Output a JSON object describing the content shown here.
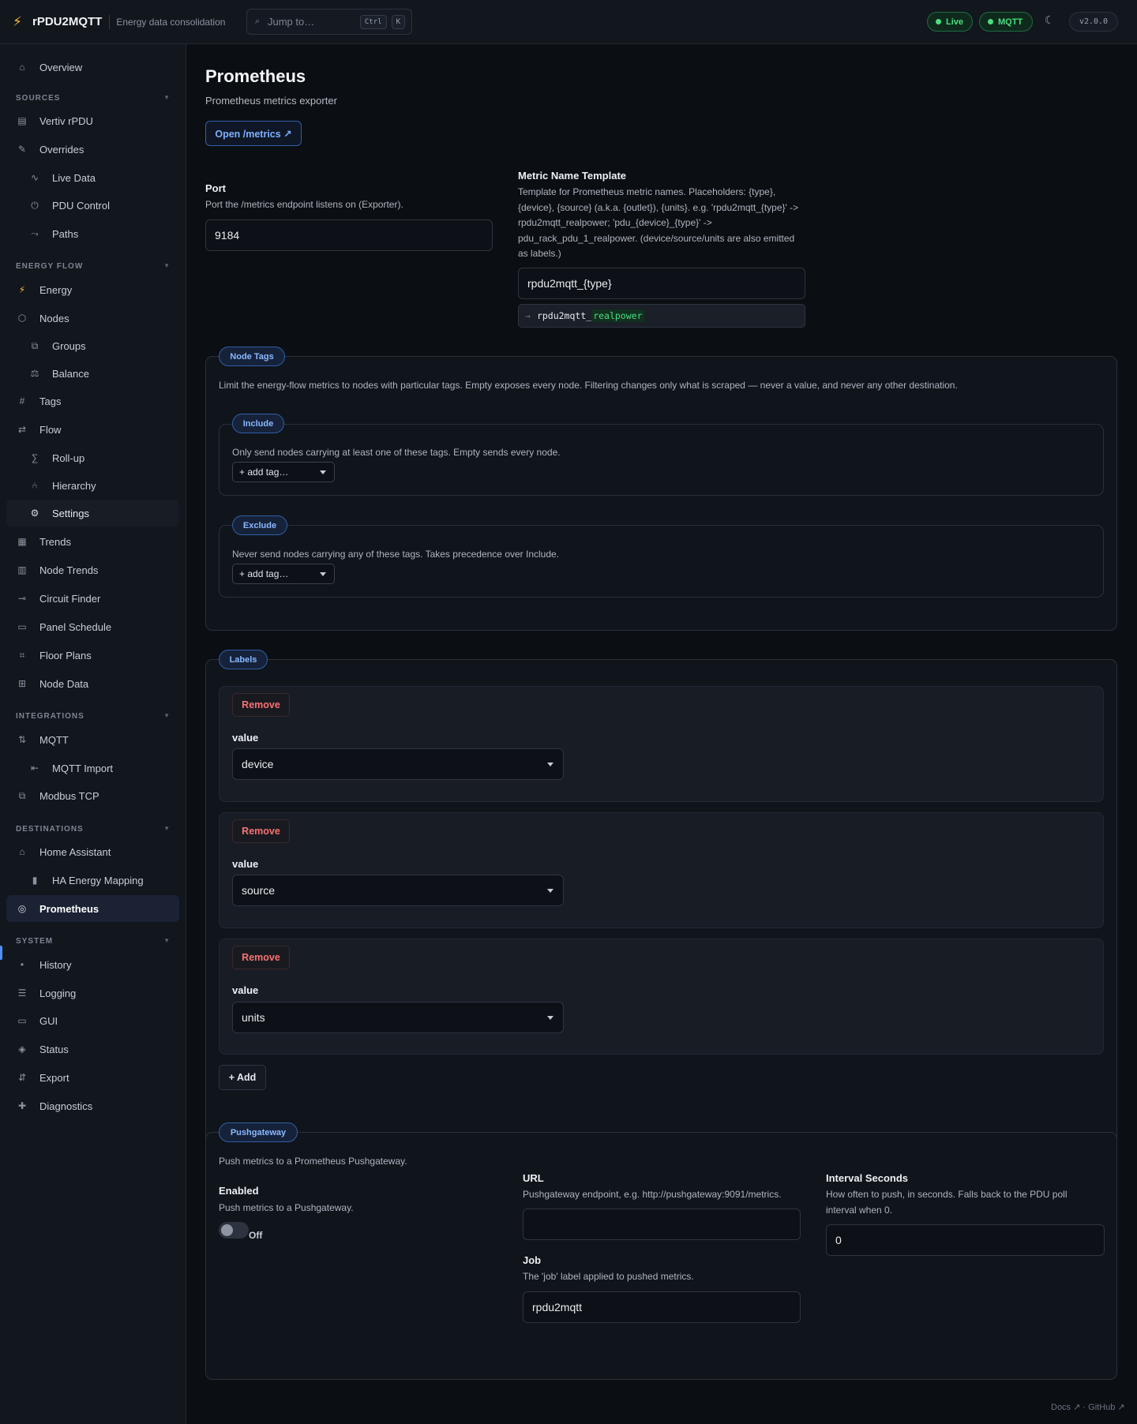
{
  "app": {
    "name": "rPDU2MQTT",
    "subtitle": "Energy data consolidation",
    "search_placeholder": "Jump to…",
    "search_kbd": [
      "Ctrl",
      "K"
    ],
    "status": [
      {
        "label": "Live",
        "color": "#4ade80"
      },
      {
        "label": "MQTT",
        "color": "#4ade80"
      }
    ],
    "theme_icon": "moon-icon",
    "version": "v2.0.0"
  },
  "sidebar": {
    "overview": {
      "label": "Overview",
      "icon": "home-icon"
    },
    "sections": [
      {
        "title": "SOURCES",
        "items": [
          {
            "label": "Vertiv rPDU",
            "icon": "server-icon",
            "level": 1
          },
          {
            "label": "Overrides",
            "icon": "pencil-icon",
            "level": 1
          },
          {
            "label": "Live Data",
            "icon": "pulse-icon",
            "level": 2
          },
          {
            "label": "PDU Control",
            "icon": "power-icon",
            "level": 2
          },
          {
            "label": "Paths",
            "icon": "route-icon",
            "level": 2
          }
        ]
      },
      {
        "title": "ENERGY FLOW",
        "items": [
          {
            "label": "Energy",
            "icon": "bolt-icon",
            "level": 1
          },
          {
            "label": "Nodes",
            "icon": "hexagon-icon",
            "level": 1
          },
          {
            "label": "Groups",
            "icon": "layers-icon",
            "level": 2
          },
          {
            "label": "Balance",
            "icon": "scale-icon",
            "level": 2
          },
          {
            "label": "Tags",
            "icon": "hash-icon",
            "level": 1
          },
          {
            "label": "Flow",
            "icon": "arrows-icon",
            "level": 1
          },
          {
            "label": "Roll-up",
            "icon": "sigma-icon",
            "level": 2
          },
          {
            "label": "Hierarchy",
            "icon": "tree-icon",
            "level": 2
          },
          {
            "label": "Settings",
            "icon": "gear-icon",
            "level": 2
          },
          {
            "label": "Trends",
            "icon": "bar-chart-icon",
            "level": 1
          },
          {
            "label": "Node Trends",
            "icon": "column-chart-icon",
            "level": 1
          },
          {
            "label": "Circuit Finder",
            "icon": "plug-icon",
            "level": 1
          },
          {
            "label": "Panel Schedule",
            "icon": "folder-icon",
            "level": 1
          },
          {
            "label": "Floor Plans",
            "icon": "grid-icon",
            "level": 1
          },
          {
            "label": "Node Data",
            "icon": "table-icon",
            "level": 1
          }
        ]
      },
      {
        "title": "INTEGRATIONS",
        "items": [
          {
            "label": "MQTT",
            "icon": "updown-icon",
            "level": 1
          },
          {
            "label": "MQTT Import",
            "icon": "import-icon",
            "level": 2
          },
          {
            "label": "Modbus TCP",
            "icon": "copy-icon",
            "level": 1
          }
        ]
      },
      {
        "title": "DESTINATIONS",
        "items": [
          {
            "label": "Home Assistant",
            "icon": "home-icon",
            "level": 1
          },
          {
            "label": "HA Energy Mapping",
            "icon": "battery-icon",
            "level": 2
          },
          {
            "label": "Prometheus",
            "icon": "target-icon",
            "level": 1
          }
        ]
      },
      {
        "title": "SYSTEM",
        "items": [
          {
            "label": "History",
            "icon": "dot-icon",
            "level": 1
          },
          {
            "label": "Logging",
            "icon": "list-icon",
            "level": 1
          },
          {
            "label": "GUI",
            "icon": "monitor-icon",
            "level": 1
          },
          {
            "label": "Status",
            "icon": "diamond-icon",
            "level": 1
          },
          {
            "label": "Export",
            "icon": "swap-icon",
            "level": 1
          },
          {
            "label": "Diagnostics",
            "icon": "cross-icon",
            "level": 1
          }
        ]
      }
    ]
  },
  "page": {
    "title": "Prometheus",
    "subtitle": "Prometheus metrics exporter",
    "open_metrics": "Open /metrics ↗",
    "port": {
      "label": "Port",
      "help": "Port the /metrics endpoint listens on (Exporter).",
      "value": "9184"
    },
    "metric_template": {
      "label": "Metric Name Template",
      "help": "Template for Prometheus metric names. Placeholders: {type}, {device}, {source} (a.k.a. {outlet}), {units}. e.g. 'rpdu2mqtt_{type}' -> rpdu2mqtt_realpower; 'pdu_{device}_{type}' -> pdu_rack_pdu_1_realpower. (device/source/units are also emitted as labels.)",
      "value": "rpdu2mqtt_{type}",
      "preview_arrow": "→",
      "preview_prefix": "rpdu2mqtt_",
      "preview_highlight": "realpower"
    },
    "node_tags": {
      "legend": "Node Tags",
      "help": "Limit the energy-flow metrics to nodes with particular tags. Empty exposes every node. Filtering changes only what is scraped — never a value, and never any other destination.",
      "include": {
        "legend": "Include",
        "help": "Only send nodes carrying at least one of these tags. Empty sends every node.",
        "select": "+ add tag…"
      },
      "exclude": {
        "legend": "Exclude",
        "help": "Never send nodes carrying any of these tags. Takes precedence over Include.",
        "select": "+ add tag…"
      }
    },
    "labels": {
      "legend": "Labels",
      "items": [
        {
          "remove": "Remove",
          "field_label": "value",
          "value": "device"
        },
        {
          "remove": "Remove",
          "field_label": "value",
          "value": "source"
        },
        {
          "remove": "Remove",
          "field_label": "value",
          "value": "units"
        }
      ],
      "add": "+ Add"
    },
    "pushgateway": {
      "legend": "Pushgateway",
      "help": "Push metrics to a Prometheus Pushgateway.",
      "enabled": {
        "label": "Enabled",
        "help": "Push metrics to a Pushgateway.",
        "state": "Off"
      },
      "url": {
        "label": "URL",
        "help": "Pushgateway endpoint, e.g. http://pushgateway:9091/metrics.",
        "value": ""
      },
      "job": {
        "label": "Job",
        "help": "The 'job' label applied to pushed metrics.",
        "value": "rpdu2mqtt"
      },
      "interval": {
        "label": "Interval Seconds",
        "help": "How often to push, in seconds. Falls back to the PDU poll interval when 0.",
        "value": "0"
      }
    }
  },
  "footer": {
    "docs": "Docs ↗",
    "sep": "·",
    "github": "GitHub ↗"
  }
}
